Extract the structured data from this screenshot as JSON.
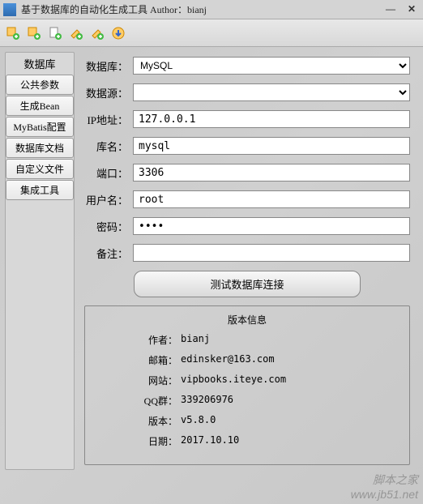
{
  "window": {
    "title": "基于数据库的自动化生成工具  Author：bianj"
  },
  "sidebar": {
    "title": "数据库",
    "items": [
      "公共参数",
      "生成Bean",
      "MyBatis配置",
      "数据库文档",
      "自定义文件",
      "集成工具"
    ]
  },
  "form": {
    "labels": {
      "database": "数据库：",
      "datasource": "数据源：",
      "ip": "IP地址：",
      "dbname": "库名：",
      "port": "端口：",
      "username": "用户名：",
      "password": "密码：",
      "remark": "备注："
    },
    "values": {
      "database": "MySQL",
      "datasource": "",
      "ip": "127.0.0.1",
      "dbname": "mysql",
      "port": "3306",
      "username": "root",
      "password": "••••",
      "remark": ""
    },
    "test_button": "测试数据库连接"
  },
  "version": {
    "title": "版本信息",
    "rows": [
      {
        "label": "作者：",
        "value": "bianj"
      },
      {
        "label": "邮箱：",
        "value": "edinsker@163.com"
      },
      {
        "label": "网站：",
        "value": "vipbooks.iteye.com"
      },
      {
        "label": "QQ群：",
        "value": "339206976"
      },
      {
        "label": "版本：",
        "value": "v5.8.0"
      },
      {
        "label": "日期：",
        "value": "2017.10.10"
      }
    ]
  },
  "watermark": {
    "line1": "脚本之家",
    "line2": "www.jb51.net"
  }
}
